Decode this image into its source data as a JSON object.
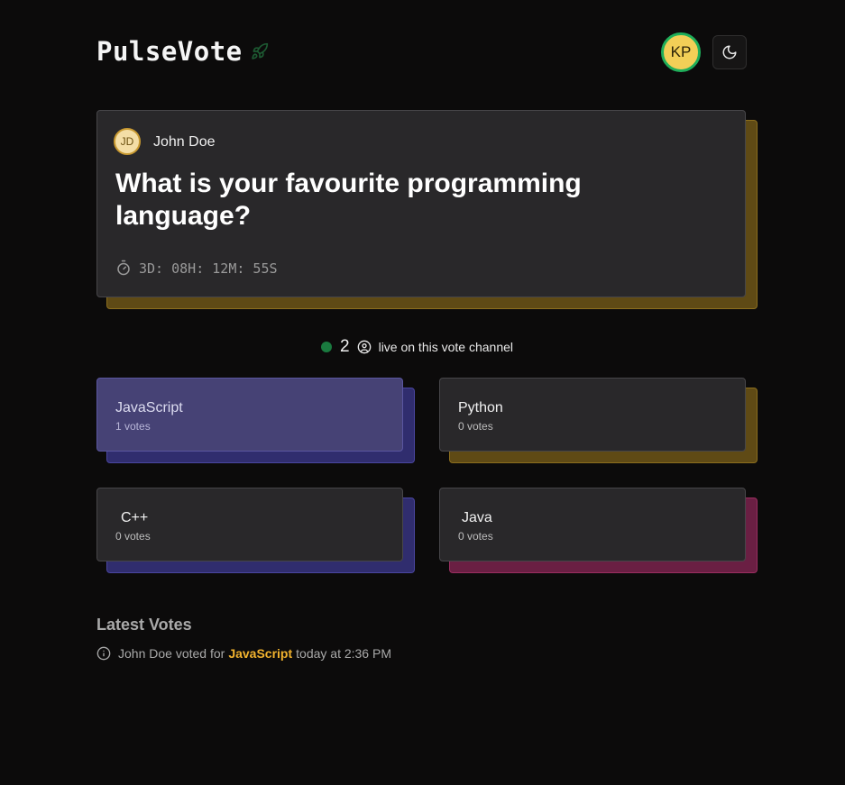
{
  "app": {
    "name": "PulseVote",
    "logo_icon": "rocket-icon"
  },
  "header": {
    "user_initials": "KP",
    "theme_toggle_icon": "moon-icon"
  },
  "poll": {
    "author_initials": "JD",
    "author_name": "John Doe",
    "question": "What is your favourite programming language?",
    "countdown": "3D: 08H: 12M: 55S"
  },
  "live": {
    "count": "2",
    "label": "live on this vote channel"
  },
  "options": [
    {
      "name": "JavaScript",
      "votes": "1 votes",
      "color": "#464275",
      "shadow": "#302d6e"
    },
    {
      "name": "Python",
      "votes": "0 votes",
      "color": "#29282a",
      "shadow": "#5f4a15"
    },
    {
      "name": "C++",
      "votes": "0 votes",
      "color": "#29282a",
      "shadow": "#302d6e"
    },
    {
      "name": "Java",
      "votes": "0 votes",
      "color": "#29282a",
      "shadow": "#6a1f43"
    }
  ],
  "latest": {
    "title": "Latest Votes",
    "items": [
      {
        "user": "John Doe",
        "verb": "voted for",
        "choice": "JavaScript",
        "time": "today at 2:36 PM"
      }
    ]
  }
}
